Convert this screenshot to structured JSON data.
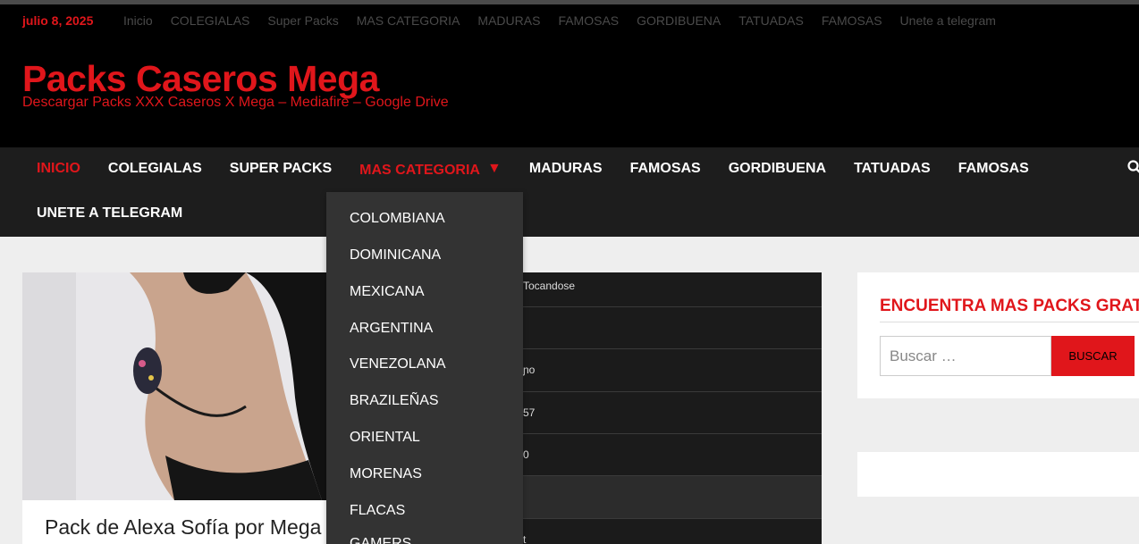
{
  "top_bar": {
    "date": "julio 8, 2025",
    "menu": [
      "Inicio",
      "COLEGIALAS",
      "Super Packs",
      "MAS CATEGORIA",
      "MADURAS",
      "FAMOSAS",
      "GORDIBUENA",
      "TATUADAS",
      "FAMOSAS",
      "Unete a telegram"
    ]
  },
  "header": {
    "site_title": "Packs Caseros Mega",
    "site_description": "Descargar Packs XXX Caseros X Mega – Mediafire – Google Drive"
  },
  "main_nav": {
    "items": [
      "INICIO",
      "COLEGIALAS",
      "SUPER PACKS",
      "MAS CATEGORIA",
      "MADURAS",
      "FAMOSAS",
      "GORDIBUENA",
      "TATUADAS",
      "FAMOSAS"
    ],
    "second_row": "UNETE A TELEGRAM",
    "active_index": 0,
    "dropdown_index": 3,
    "dropdown_items": [
      "COLOMBIANA",
      "DOMINICANA",
      "MEXICANA",
      "ARGENTINA",
      "VENEZOLANA",
      "BRAZILEÑAS",
      "ORIENTAL",
      "MORENAS",
      "FLACAS",
      "GAMERS"
    ]
  },
  "post": {
    "title": "Pack de Alexa Sofía por Mega y"
  },
  "dark_list_fragments": [
    "Tocandose",
    "",
    "ɲo",
    "57",
    "0",
    "",
    "t"
  ],
  "sidebar": {
    "widget_title": "ENCUENTRA MAS PACKS GRATIS",
    "search_placeholder": "Buscar …",
    "search_button": "BUSCAR"
  },
  "colors": {
    "accent": "#e0161b",
    "topbar_bg": "#000000",
    "nav_bg": "#1d1d1d",
    "dropdown_bg": "#333333",
    "page_bg": "#eeeeee"
  }
}
